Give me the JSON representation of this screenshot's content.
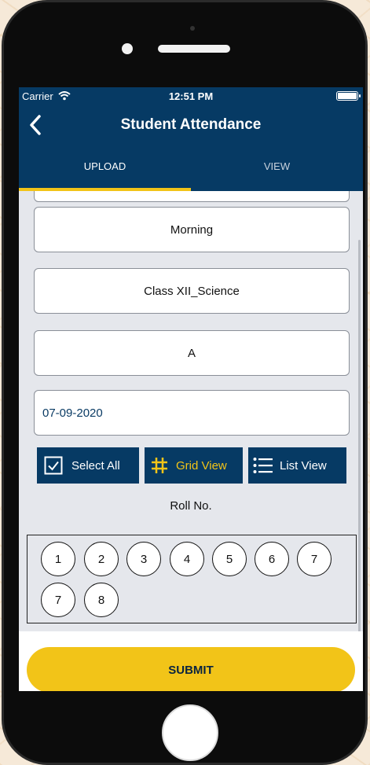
{
  "status_bar": {
    "carrier": "Carrier",
    "time": "12:51 PM"
  },
  "nav": {
    "title": "Student Attendance",
    "back_icon": "chevron-left-icon"
  },
  "tabs": [
    {
      "label": "UPLOAD",
      "active": true
    },
    {
      "label": "VIEW",
      "active": false
    }
  ],
  "form": {
    "session": "Morning",
    "class": "Class XII_Science",
    "section": "A",
    "date": "07-09-2020"
  },
  "view_buttons": {
    "select_all": "Select All",
    "grid_view": "Grid View",
    "list_view": "List View"
  },
  "roll_label": "Roll No.",
  "roll_numbers": [
    "1",
    "2",
    "3",
    "4",
    "5",
    "6",
    "7",
    "7",
    "8"
  ],
  "submit_label": "SUBMIT",
  "colors": {
    "primary": "#063a64",
    "accent": "#f2c418",
    "background": "#e5e7ec"
  }
}
